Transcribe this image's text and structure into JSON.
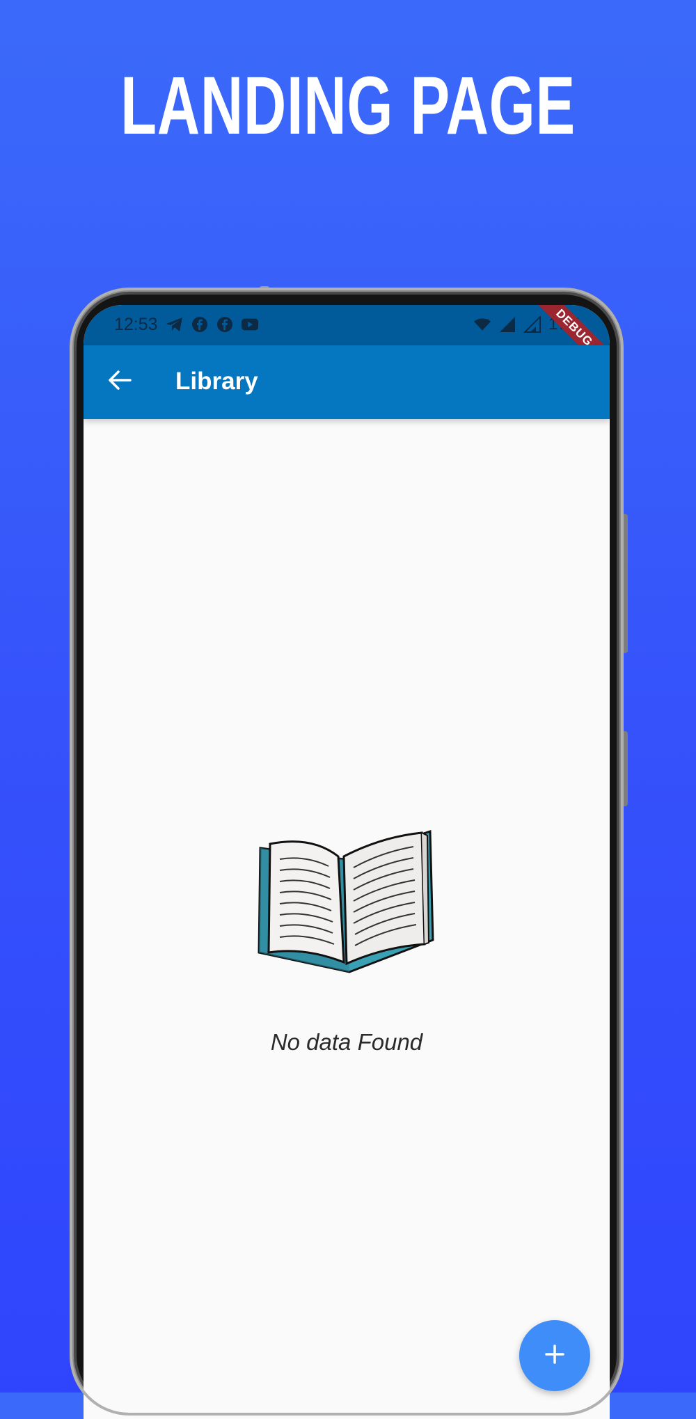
{
  "headline": "LANDING PAGE",
  "status_bar": {
    "time": "12:53",
    "left_icons": [
      "telegram-icon",
      "facebook-icon",
      "facebook-icon",
      "youtube-icon"
    ],
    "right_icons": [
      "wifi-icon",
      "signal-icon",
      "signal-icon"
    ],
    "battery": "17%"
  },
  "debug_banner": "DEBUG",
  "appbar": {
    "back_icon": "arrow-left-icon",
    "title": "Library"
  },
  "empty_state": {
    "illustration": "open-book-icon",
    "message": "No data Found"
  },
  "fab": {
    "icon": "plus-icon"
  },
  "colors": {
    "background_top": "#3b6af9",
    "background_bottom": "#2f45fd",
    "status_bar": "#015b9b",
    "app_bar": "#0477c0",
    "fab": "#3f8df8",
    "book_cover": "#3aa0b3"
  }
}
